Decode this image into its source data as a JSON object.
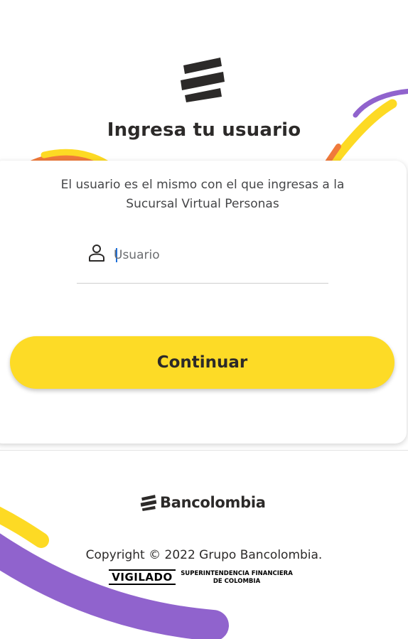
{
  "header": {
    "logo": "bancolombia-symbol-icon",
    "title": "Ingresa tu usuario"
  },
  "card": {
    "subtitle": "El usuario es el mismo con el que ingresas a la Sucursal Virtual Personas",
    "username_field": {
      "icon": "user-icon",
      "placeholder": "Usuario",
      "value": ""
    },
    "continue_label": "Continuar"
  },
  "footer": {
    "brand_name": "Bancolombia",
    "copyright": "Copyright © 2022 Grupo Bancolombia.",
    "vigilado": "VIGILADO",
    "supervisor_line1": "SUPERINTENDENCIA FINANCIERA",
    "supervisor_line2": "DE COLOMBIA"
  },
  "colors": {
    "primary_yellow": "#FDDA24",
    "text_dark": "#2C2A29",
    "accent_purple": "#9063CD",
    "accent_orange": "#F07A3B"
  }
}
